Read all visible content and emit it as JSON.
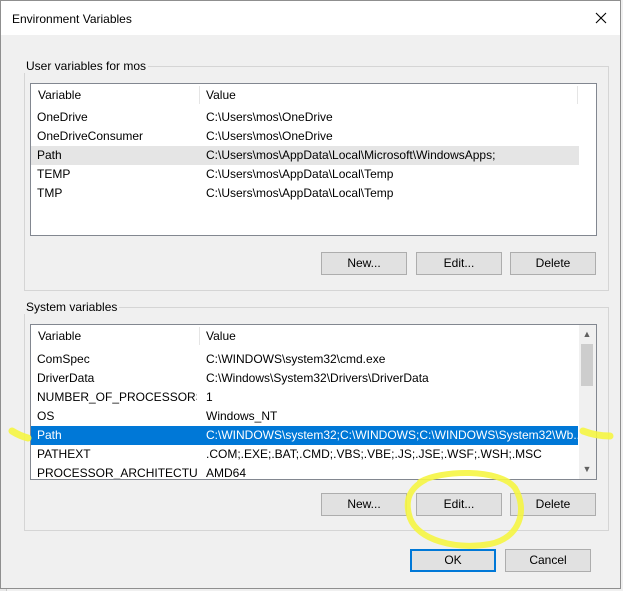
{
  "window": {
    "title": "Environment Variables"
  },
  "user_group": {
    "label": "User variables for mos",
    "headers": {
      "variable": "Variable",
      "value": "Value"
    },
    "rows": [
      {
        "variable": "OneDrive",
        "value": "C:\\Users\\mos\\OneDrive"
      },
      {
        "variable": "OneDriveConsumer",
        "value": "C:\\Users\\mos\\OneDrive"
      },
      {
        "variable": "Path",
        "value": "C:\\Users\\mos\\AppData\\Local\\Microsoft\\WindowsApps;"
      },
      {
        "variable": "TEMP",
        "value": "C:\\Users\\mos\\AppData\\Local\\Temp"
      },
      {
        "variable": "TMP",
        "value": "C:\\Users\\mos\\AppData\\Local\\Temp"
      }
    ],
    "buttons": {
      "new": "New...",
      "edit": "Edit...",
      "delete": "Delete"
    }
  },
  "system_group": {
    "label": "System variables",
    "headers": {
      "variable": "Variable",
      "value": "Value"
    },
    "rows": [
      {
        "variable": "ComSpec",
        "value": "C:\\WINDOWS\\system32\\cmd.exe"
      },
      {
        "variable": "DriverData",
        "value": "C:\\Windows\\System32\\Drivers\\DriverData"
      },
      {
        "variable": "NUMBER_OF_PROCESSORS",
        "value": "1"
      },
      {
        "variable": "OS",
        "value": "Windows_NT"
      },
      {
        "variable": "Path",
        "value": "C:\\WINDOWS\\system32;C:\\WINDOWS;C:\\WINDOWS\\System32\\Wb..."
      },
      {
        "variable": "PATHEXT",
        "value": ".COM;.EXE;.BAT;.CMD;.VBS;.VBE;.JS;.JSE;.WSF;.WSH;.MSC"
      },
      {
        "variable": "PROCESSOR_ARCHITECTURE",
        "value": "AMD64"
      }
    ],
    "buttons": {
      "new": "New...",
      "edit": "Edit...",
      "delete": "Delete"
    }
  },
  "footer": {
    "ok": "OK",
    "cancel": "Cancel"
  },
  "colors": {
    "selection": "#0078d7",
    "highlighter": "#f5f542"
  }
}
